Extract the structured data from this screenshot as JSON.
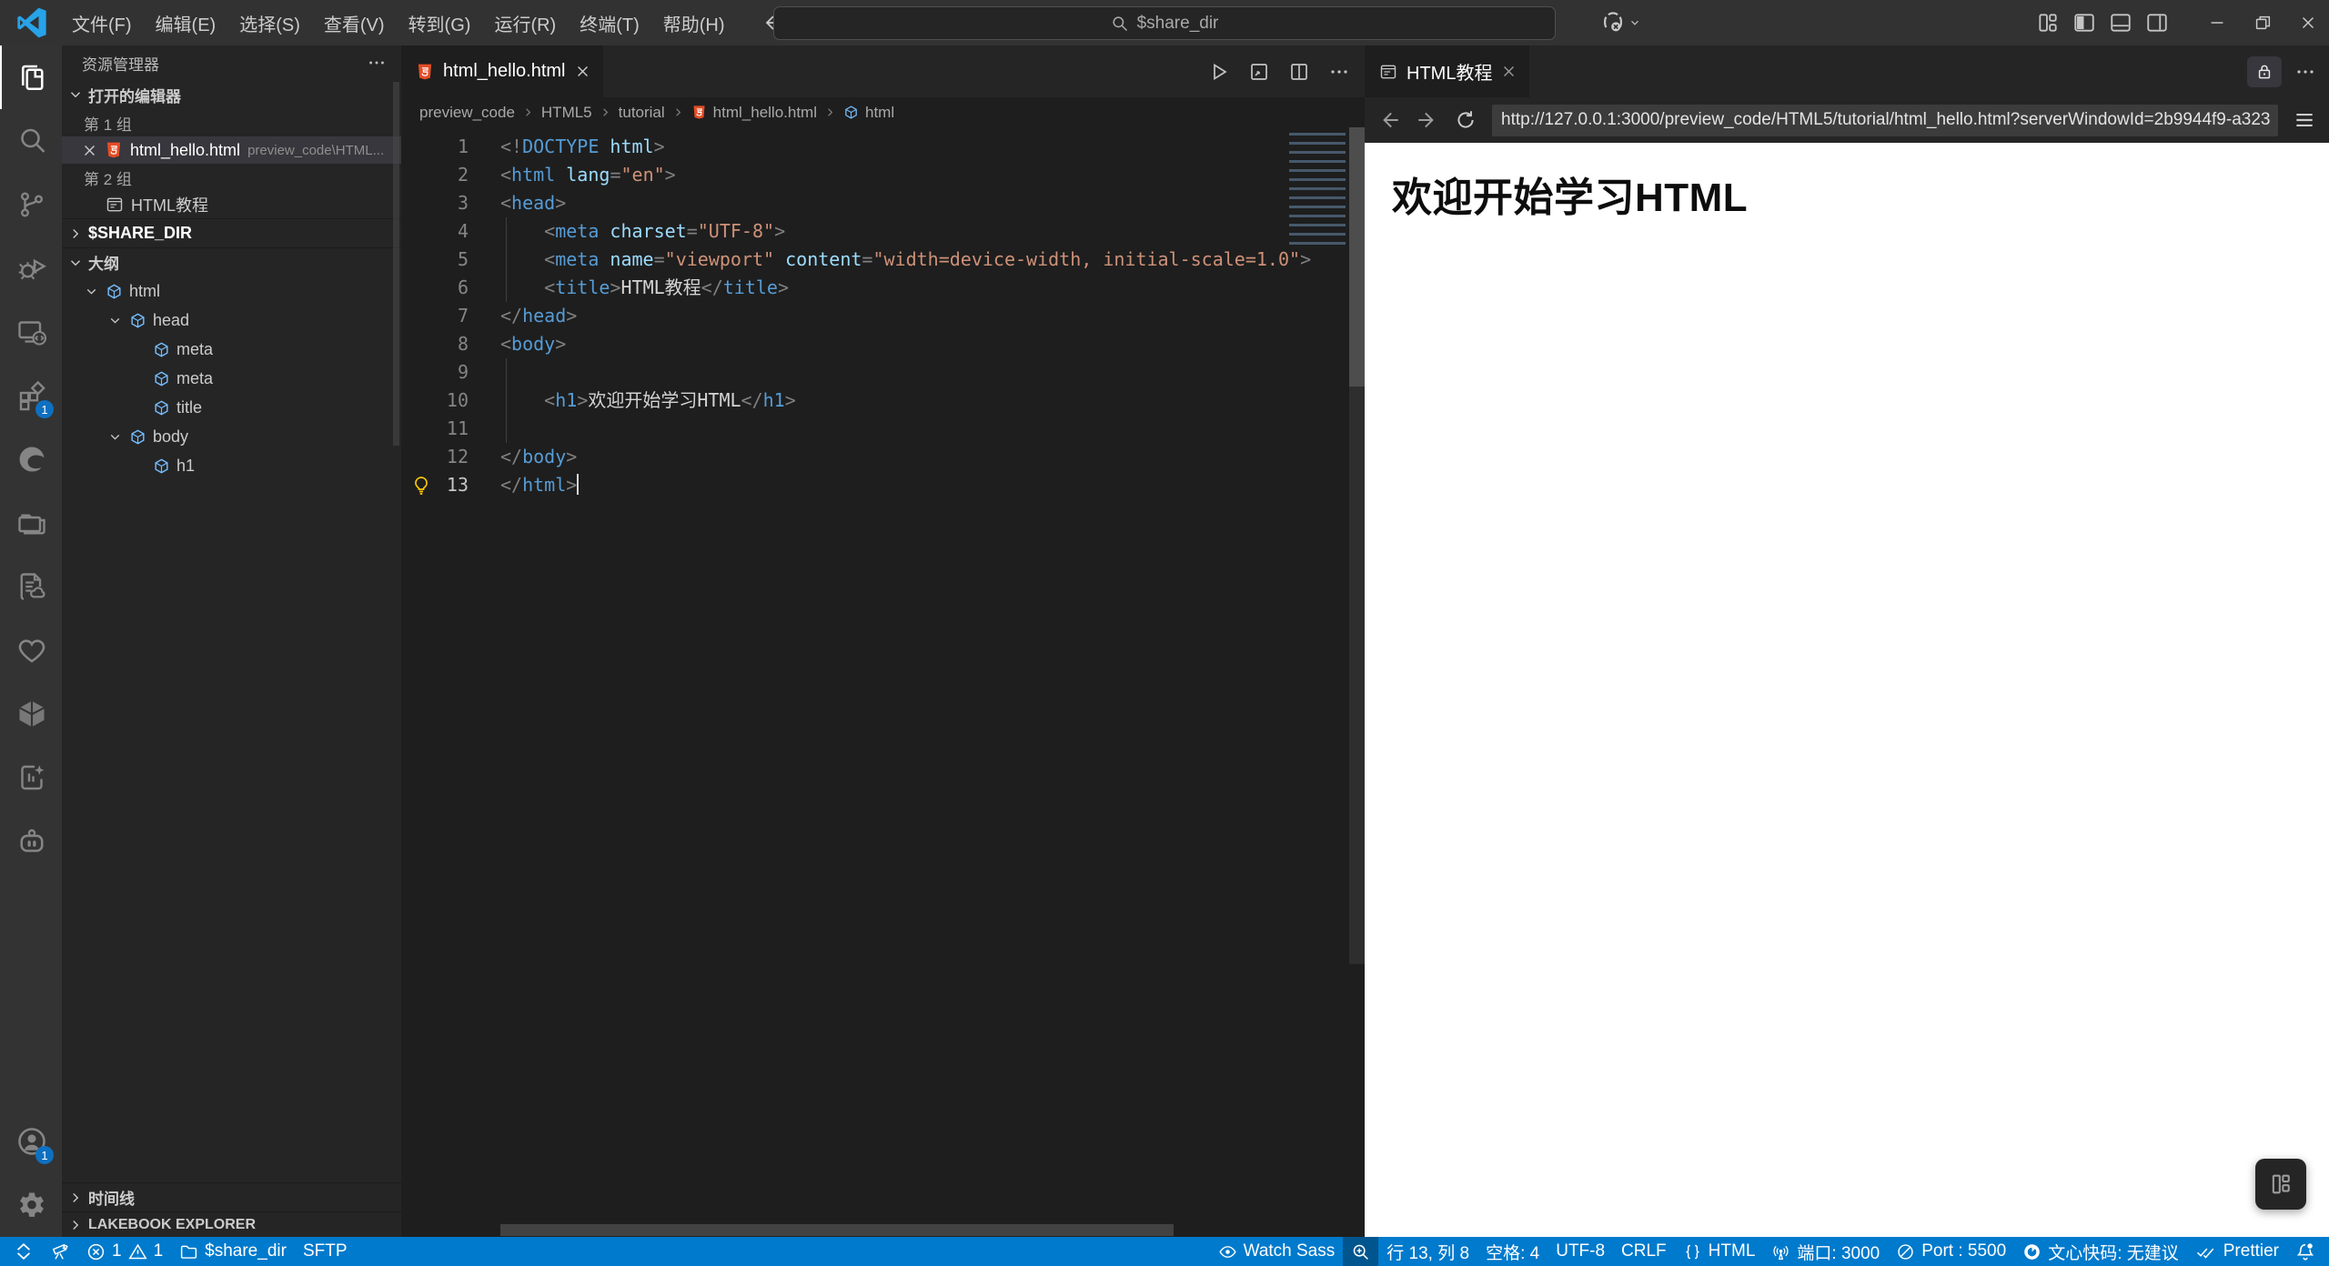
{
  "title_bar": {
    "menus": [
      "文件(F)",
      "编辑(E)",
      "选择(S)",
      "查看(V)",
      "转到(G)",
      "运行(R)",
      "终端(T)",
      "帮助(H)"
    ],
    "search_text": "$share_dir"
  },
  "activity_bar": {
    "extensions_badge": "1",
    "account_badge": "1"
  },
  "sidebar": {
    "title": "资源管理器",
    "open_editors_label": "打开的编辑器",
    "group1_label": "第 1 组",
    "file1_name": "html_hello.html",
    "file1_path": "preview_code\\HTML...",
    "group2_label": "第 2 组",
    "file2_name": "HTML教程",
    "folder_section_label": "$SHARE_DIR",
    "outline_label": "大纲",
    "outline_nodes": [
      {
        "depth": 0,
        "label": "html",
        "expandable": true
      },
      {
        "depth": 1,
        "label": "head",
        "expandable": true
      },
      {
        "depth": 2,
        "label": "meta"
      },
      {
        "depth": 2,
        "label": "meta"
      },
      {
        "depth": 2,
        "label": "title"
      },
      {
        "depth": 1,
        "label": "body",
        "expandable": true
      },
      {
        "depth": 2,
        "label": "h1"
      }
    ],
    "timeline_label": "时间线",
    "lakebook_label": "LAKEBOOK EXPLORER"
  },
  "editor": {
    "tab_label": "html_hello.html",
    "breadcrumbs": [
      "preview_code",
      "HTML5",
      "tutorial",
      "html_hello.html",
      "html"
    ],
    "lines": [
      {
        "n": "1",
        "tokens": [
          {
            "c": "p",
            "t": "<!"
          },
          {
            "c": "tag",
            "t": "DOCTYPE"
          },
          {
            "c": "attr",
            "t": " html"
          },
          {
            "c": "p",
            "t": ">"
          }
        ]
      },
      {
        "n": "2",
        "tokens": [
          {
            "c": "p",
            "t": "<"
          },
          {
            "c": "tag",
            "t": "html"
          },
          {
            "c": "attr",
            "t": " lang"
          },
          {
            "c": "p",
            "t": "="
          },
          {
            "c": "str",
            "t": "\"en\""
          },
          {
            "c": "p",
            "t": ">"
          }
        ]
      },
      {
        "n": "3",
        "tokens": [
          {
            "c": "p",
            "t": "<"
          },
          {
            "c": "tag",
            "t": "head"
          },
          {
            "c": "p",
            "t": ">"
          }
        ]
      },
      {
        "n": "4",
        "tokens": [
          {
            "c": "txt",
            "t": "    "
          },
          {
            "c": "p",
            "t": "<"
          },
          {
            "c": "tag",
            "t": "meta"
          },
          {
            "c": "attr",
            "t": " charset"
          },
          {
            "c": "p",
            "t": "="
          },
          {
            "c": "str",
            "t": "\"UTF-8\""
          },
          {
            "c": "p",
            "t": ">"
          }
        ]
      },
      {
        "n": "5",
        "tokens": [
          {
            "c": "txt",
            "t": "    "
          },
          {
            "c": "p",
            "t": "<"
          },
          {
            "c": "tag",
            "t": "meta"
          },
          {
            "c": "attr",
            "t": " name"
          },
          {
            "c": "p",
            "t": "="
          },
          {
            "c": "str",
            "t": "\"viewport\""
          },
          {
            "c": "attr",
            "t": " content"
          },
          {
            "c": "p",
            "t": "="
          },
          {
            "c": "str",
            "t": "\"width=device-width, initial-scale=1.0\""
          },
          {
            "c": "p",
            "t": ">"
          }
        ]
      },
      {
        "n": "6",
        "tokens": [
          {
            "c": "txt",
            "t": "    "
          },
          {
            "c": "p",
            "t": "<"
          },
          {
            "c": "tag",
            "t": "title"
          },
          {
            "c": "p",
            "t": ">"
          },
          {
            "c": "txt",
            "t": "HTML教程"
          },
          {
            "c": "p",
            "t": "</"
          },
          {
            "c": "tag",
            "t": "title"
          },
          {
            "c": "p",
            "t": ">"
          }
        ]
      },
      {
        "n": "7",
        "tokens": [
          {
            "c": "p",
            "t": "</"
          },
          {
            "c": "tag",
            "t": "head"
          },
          {
            "c": "p",
            "t": ">"
          }
        ]
      },
      {
        "n": "8",
        "tokens": [
          {
            "c": "p",
            "t": "<"
          },
          {
            "c": "tag",
            "t": "body"
          },
          {
            "c": "p",
            "t": ">"
          }
        ]
      },
      {
        "n": "9",
        "tokens": []
      },
      {
        "n": "10",
        "tokens": [
          {
            "c": "txt",
            "t": "    "
          },
          {
            "c": "p",
            "t": "<"
          },
          {
            "c": "tag",
            "t": "h1"
          },
          {
            "c": "p",
            "t": ">"
          },
          {
            "c": "txt",
            "t": "欢迎开始学习HTML"
          },
          {
            "c": "p",
            "t": "</"
          },
          {
            "c": "tag",
            "t": "h1"
          },
          {
            "c": "p",
            "t": ">"
          }
        ]
      },
      {
        "n": "11",
        "tokens": []
      },
      {
        "n": "12",
        "tokens": [
          {
            "c": "p",
            "t": "</"
          },
          {
            "c": "tag",
            "t": "body"
          },
          {
            "c": "p",
            "t": ">"
          }
        ]
      },
      {
        "n": "13",
        "active": true,
        "cursor": true,
        "tokens": [
          {
            "c": "p",
            "t": "</"
          },
          {
            "c": "tag",
            "t": "html"
          },
          {
            "c": "p",
            "t": ">"
          }
        ]
      }
    ]
  },
  "preview": {
    "tab_label": "HTML教程",
    "url": "http://127.0.0.1:3000/preview_code/HTML5/tutorial/html_hello.html?serverWindowId=2b9944f9-a323",
    "heading": "欢迎开始学习HTML"
  },
  "status_bar": {
    "errors": "1",
    "warnings": "1",
    "folder": "$share_dir",
    "sftp": "SFTP",
    "watch_sass": "Watch Sass",
    "cursor_pos": "行 13, 列 8",
    "indent": "空格: 4",
    "encoding": "UTF-8",
    "eol": "CRLF",
    "language": "HTML",
    "port_cn": "端口: 3000",
    "port_en": "Port : 5500",
    "comate": "文心快码: 无建议",
    "prettier": "Prettier"
  }
}
